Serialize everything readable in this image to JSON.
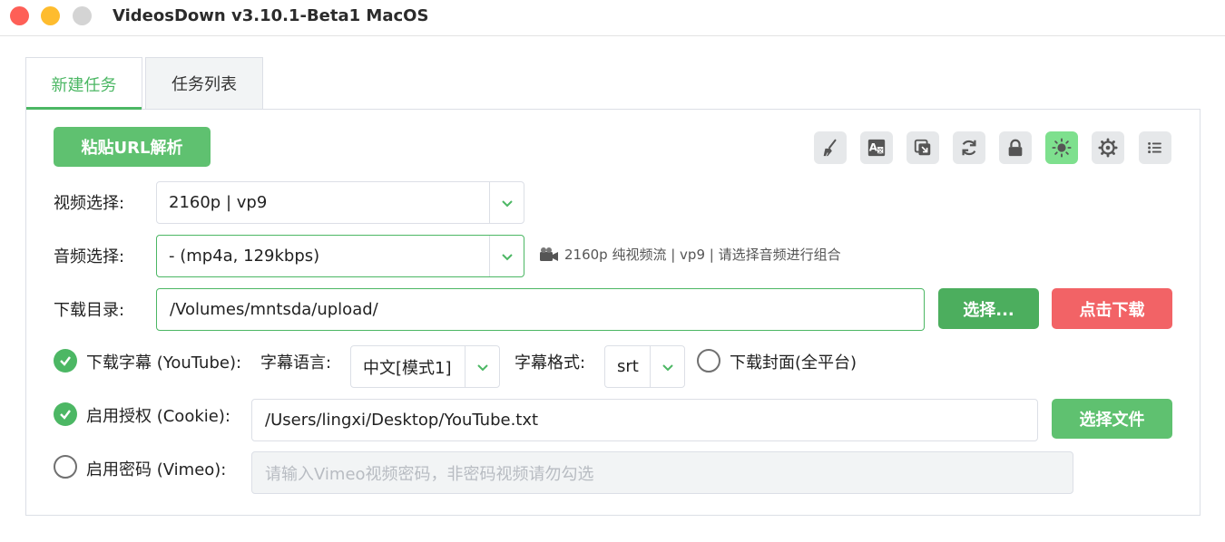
{
  "window": {
    "title": "VideosDown v3.10.1-Beta1 MacOS"
  },
  "tabs": [
    {
      "label": "新建任务",
      "active": true
    },
    {
      "label": "任务列表",
      "active": false
    }
  ],
  "toolbar": {
    "paste_label": "粘贴URL解析",
    "icons": [
      "broom-icon",
      "font-icon",
      "copy-icon",
      "refresh-icon",
      "lock-icon",
      "sun-icon",
      "gear-icon",
      "list-icon"
    ],
    "active_icon": "sun-icon"
  },
  "video": {
    "label": "视频选择:",
    "value": "2160p | vp9"
  },
  "audio": {
    "label": "音频选择:",
    "value": "- (mp4a, 129kbps)"
  },
  "info_text": "2160p 纯视频流 | vp9 | 请选择音频进行组合",
  "download_dir": {
    "label": "下载目录:",
    "value": "/Volumes/mntsda/upload/",
    "choose_label": "选择...",
    "download_label": "点击下载"
  },
  "subtitles": {
    "checkbox_label": "下载字幕 (YouTube):",
    "checked": true,
    "lang_label": "字幕语言:",
    "lang_value": "中文[模式1]",
    "format_label": "字幕格式:",
    "format_value": "srt",
    "cover_label": "下载封面(全平台)",
    "cover_checked": false
  },
  "cookie": {
    "checkbox_label": "启用授权 (Cookie):",
    "checked": true,
    "value": "/Users/lingxi/Desktop/YouTube.txt",
    "file_button_label": "选择文件"
  },
  "password": {
    "checkbox_label": "启用密码 (Vimeo):",
    "checked": false,
    "placeholder": "请输入Vimeo视频密码，非密码视频请勿勾选"
  },
  "colors": {
    "accent": "#4cb764",
    "danger": "#f26366"
  }
}
